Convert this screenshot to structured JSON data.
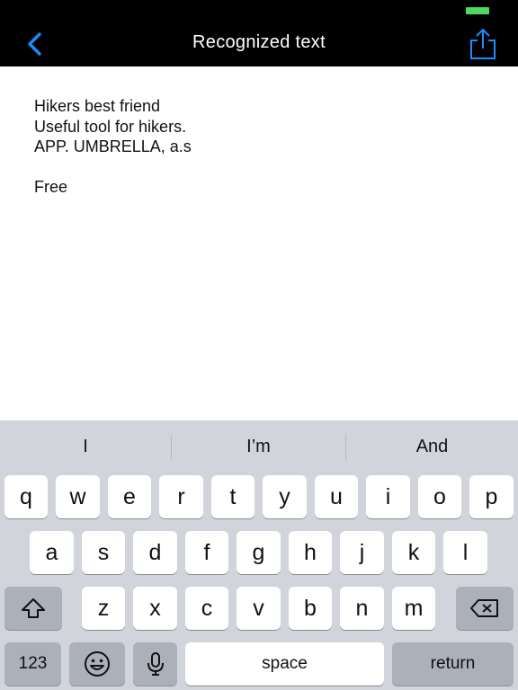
{
  "header": {
    "title": "Recognized text",
    "accent_color": "#1a8cff",
    "battery_color": "#4cd964"
  },
  "document": {
    "lines": [
      "Hikers best friend",
      "Useful tool for hikers.",
      "APP. UMBRELLA, a.s",
      "",
      "Free"
    ]
  },
  "keyboard": {
    "suggestions": [
      "I",
      "I’m",
      "And"
    ],
    "row1": [
      "q",
      "w",
      "e",
      "r",
      "t",
      "y",
      "u",
      "i",
      "o",
      "p"
    ],
    "row2": [
      "a",
      "s",
      "d",
      "f",
      "g",
      "h",
      "j",
      "k",
      "l"
    ],
    "row3": [
      "z",
      "x",
      "c",
      "v",
      "b",
      "n",
      "m"
    ],
    "numbers_label": "123",
    "space_label": "space",
    "return_label": "return",
    "icons": {
      "shift": "shift-icon",
      "delete": "delete-icon",
      "emoji": "emoji-icon",
      "mic": "microphone-icon"
    }
  }
}
